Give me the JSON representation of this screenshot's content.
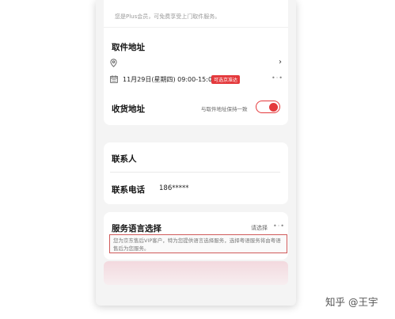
{
  "plus_notice": "您是Plus会员，可免费享受上门取件服务。",
  "pickup": {
    "title": "取件地址",
    "address": "",
    "date": "11月29日(星期四) 09:00-15:00",
    "badge": "可选京准达"
  },
  "receive": {
    "title": "收货地址",
    "same_as_pickup": "与取件地址保持一致",
    "toggle_on": true,
    "accent_color": "#e4393c"
  },
  "contact": {
    "person_label": "联系人",
    "phone_label": "联系电话",
    "phone_value": "186*****"
  },
  "language": {
    "title": "服务语言选择",
    "select_label": "请选择",
    "info": "您为京东售后VIP客户，特为您提供语言选择服务，选择粤语服务将由粤语售后为您服务。"
  },
  "watermark": "知乎 @王宇"
}
